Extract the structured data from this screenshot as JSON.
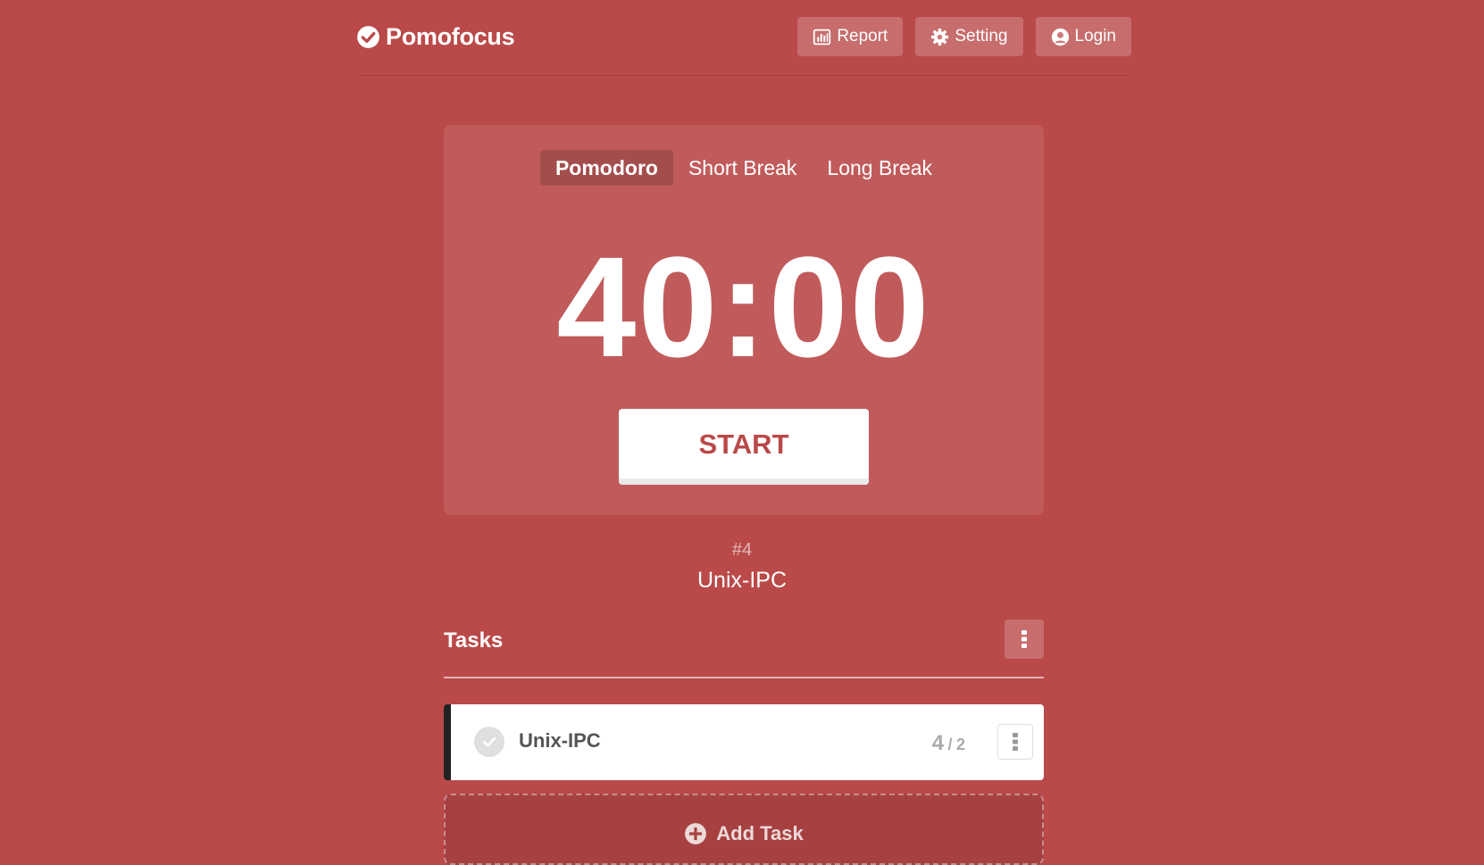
{
  "colors": {
    "background": "#ba4949",
    "accent": "#ba4949",
    "task_marker": "#222222"
  },
  "header": {
    "logo_text": "Pomofocus",
    "logo_icon": "check-circle-icon",
    "nav": [
      {
        "label": "Report",
        "icon": "bar-chart-icon"
      },
      {
        "label": "Setting",
        "icon": "gear-icon"
      },
      {
        "label": "Login",
        "icon": "user-circle-icon"
      }
    ]
  },
  "timer": {
    "modes": [
      {
        "label": "Pomodoro",
        "active": true
      },
      {
        "label": "Short Break",
        "active": false
      },
      {
        "label": "Long Break",
        "active": false
      }
    ],
    "time": "40:00",
    "start_label": "START"
  },
  "session": {
    "number": "#4",
    "current_task": "Unix-IPC"
  },
  "tasks": {
    "title": "Tasks",
    "items": [
      {
        "name": "Unix-IPC",
        "done": "4",
        "slash": "/",
        "estimate": "2"
      }
    ],
    "add_label": "Add Task"
  }
}
